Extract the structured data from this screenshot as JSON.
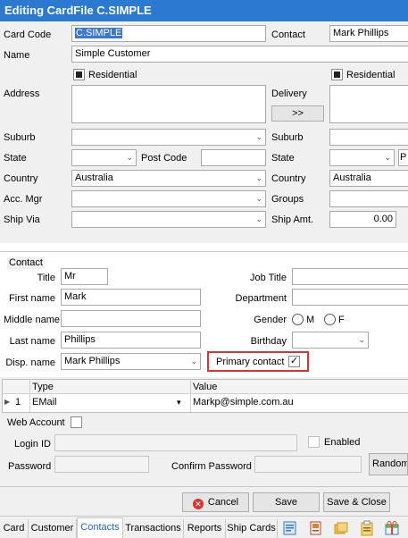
{
  "window": {
    "title": "Editing CardFile C.SIMPLE"
  },
  "card": {
    "card_code_label": "Card Code",
    "card_code": "C.SIMPLE",
    "contact_label": "Contact",
    "contact": "Mark Phillips",
    "name_label": "Name",
    "name": "Simple Customer",
    "residential_label": "Residential",
    "delivery_residential_label": "Residential",
    "address_label": "Address",
    "delivery_label": "Delivery",
    "copy_button": ">>",
    "suburb_label": "Suburb",
    "delivery_suburb_label": "Suburb",
    "state_label": "State",
    "post_code_label": "Post Code",
    "delivery_state_label": "State",
    "delivery_post_code": "P",
    "country_label": "Country",
    "country": "Australia",
    "delivery_country_label": "Country",
    "delivery_country": "Australia",
    "acc_mgr_label": "Acc. Mgr",
    "groups_label": "Groups",
    "ship_via_label": "Ship Via",
    "ship_amt_label": "Ship Amt.",
    "ship_amt": "0.00"
  },
  "contact_group": {
    "legend": "Contact",
    "title_label": "Title",
    "title": "Mr",
    "job_title_label": "Job Title",
    "first_name_label": "First name",
    "first_name": "Mark",
    "department_label": "Department",
    "middle_name_label": "Middle name",
    "gender_label": "Gender",
    "gender_m": "M",
    "gender_f": "F",
    "last_name_label": "Last name",
    "last_name": "Phillips",
    "birthday_label": "Birthday",
    "disp_name_label": "Disp. name",
    "disp_name": "Mark Phillips",
    "primary_contact_label": "Primary contact",
    "primary_contact_checked": true
  },
  "contact_grid": {
    "columns": [
      "Type",
      "Value"
    ],
    "rows": [
      {
        "num": "1",
        "type": "EMail",
        "value": "Markp@simple.com.au"
      }
    ]
  },
  "web_account": {
    "label": "Web Account",
    "login_id_label": "Login ID",
    "enabled_label": "Enabled",
    "password_label": "Password",
    "confirm_password_label": "Confirm Password",
    "random_button": "Random"
  },
  "actions": {
    "cancel": "Cancel",
    "save": "Save",
    "save_close": "Save & Close"
  },
  "tabs": [
    "Card",
    "Customer",
    "Contacts",
    "Transactions",
    "Reports",
    "Ship Cards"
  ],
  "active_tab": "Contacts",
  "colors": {
    "title_bar": "#2b79d1",
    "highlight": "#e03030",
    "active_tab_text": "#1a64c5",
    "selection": "#3877d6"
  }
}
